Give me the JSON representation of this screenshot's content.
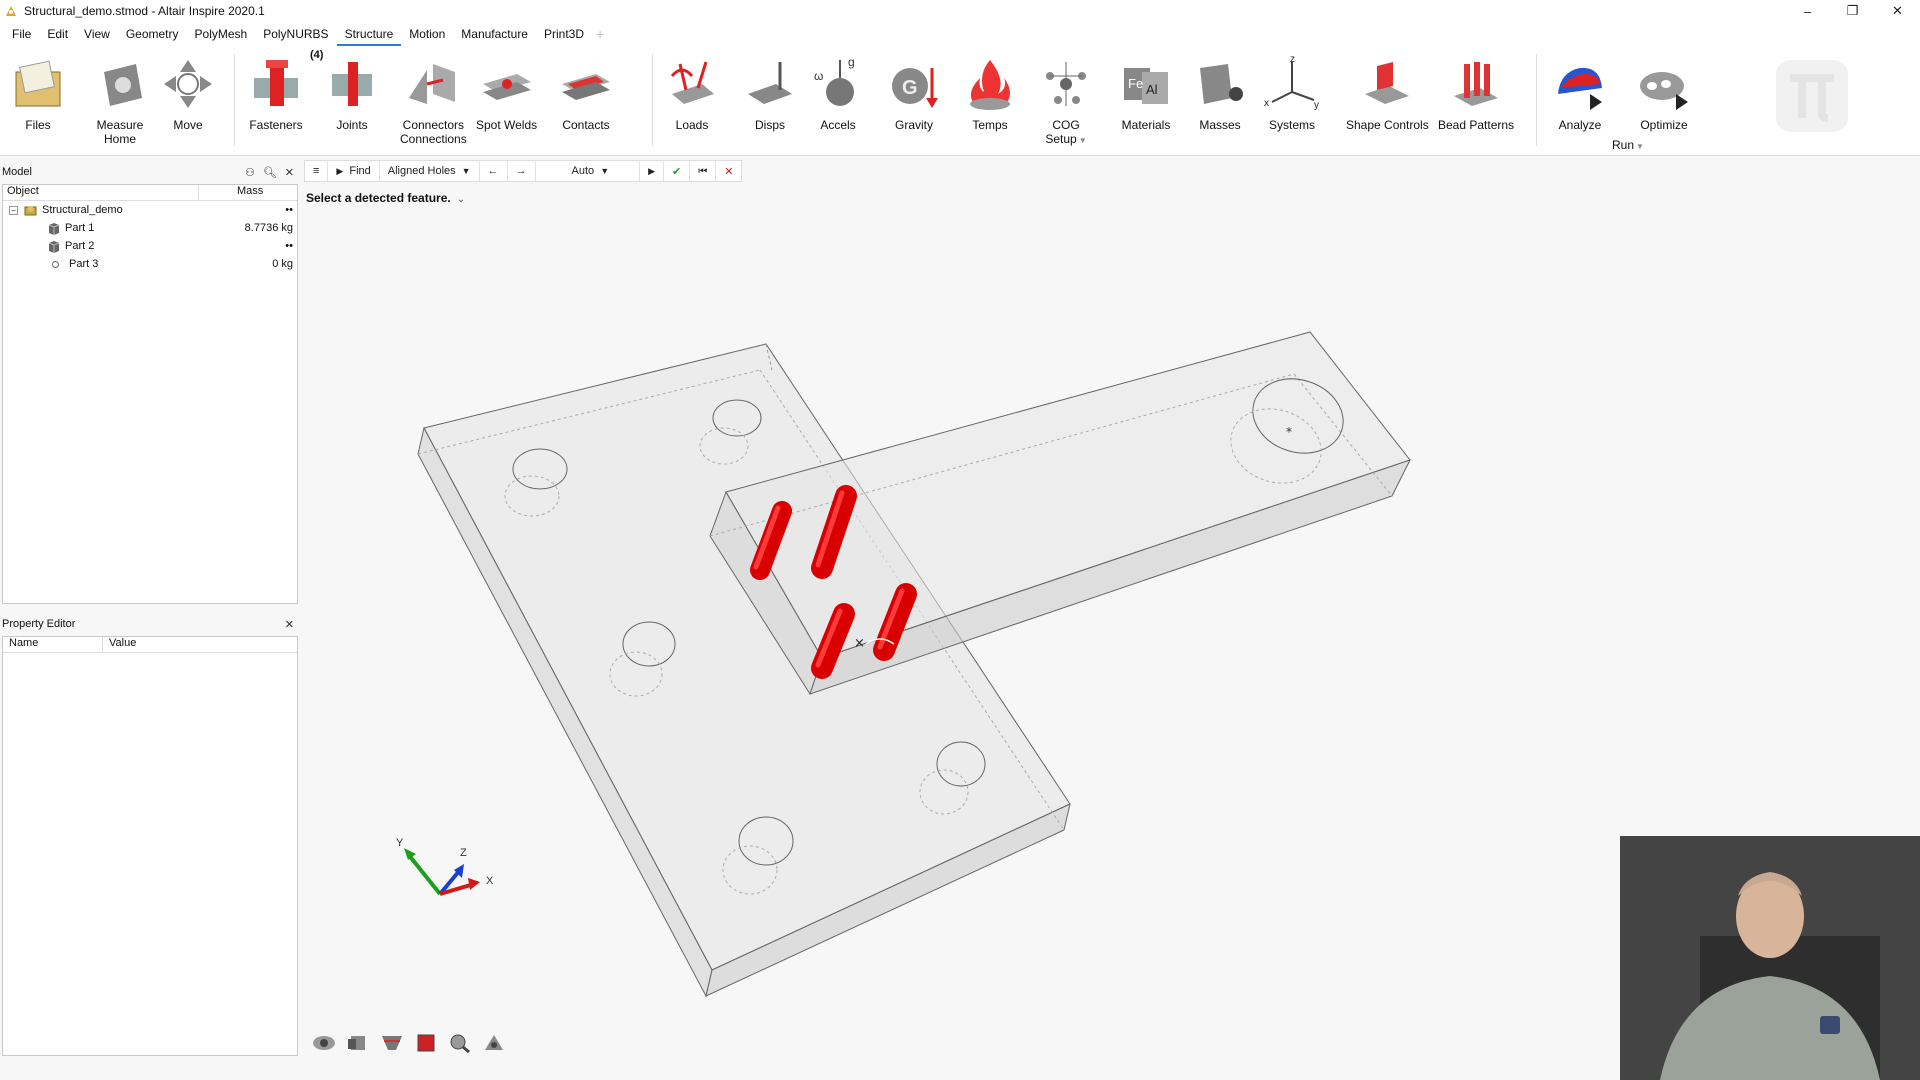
{
  "window": {
    "title": "Structural_demo.stmod - Altair Inspire 2020.1",
    "minimize": "–",
    "maximize": "❐",
    "close": "✕"
  },
  "menu": [
    "File",
    "Edit",
    "View",
    "Geometry",
    "PolyMesh",
    "PolyNURBS",
    "Structure",
    "Motion",
    "Manufacture",
    "Print3D"
  ],
  "menu_active": "Structure",
  "menu_add": "+",
  "ribbon": {
    "badge": "(4)",
    "buttons": [
      {
        "label": "Files",
        "icon": "files-icon"
      },
      {
        "label": "Measure\nHome",
        "icon": "measure-icon"
      },
      {
        "label": "Move",
        "icon": "move-icon"
      },
      {
        "label": "Fasteners",
        "icon": "fasteners-icon"
      },
      {
        "label": "Joints",
        "icon": "joints-icon"
      },
      {
        "label": "Connectors\nConnections",
        "icon": "connectors-icon"
      },
      {
        "label": "Spot Welds",
        "icon": "spot-welds-icon"
      },
      {
        "label": "Contacts",
        "icon": "contacts-icon"
      },
      {
        "label": "Loads",
        "icon": "loads-icon"
      },
      {
        "label": "Disps",
        "icon": "disps-icon"
      },
      {
        "label": "Accels",
        "icon": "accels-icon"
      },
      {
        "label": "Gravity",
        "icon": "gravity-icon"
      },
      {
        "label": "Temps",
        "icon": "temps-icon"
      },
      {
        "label": "COG\nSetup",
        "icon": "cog-icon"
      },
      {
        "label": "Materials",
        "icon": "materials-icon"
      },
      {
        "label": "Masses",
        "icon": "masses-icon"
      },
      {
        "label": "Systems",
        "icon": "systems-icon"
      },
      {
        "label": "Shape Controls",
        "icon": "shape-controls-icon"
      },
      {
        "label": "Bead Patterns",
        "icon": "bead-patterns-icon"
      },
      {
        "label": "Analyze",
        "icon": "analyze-icon"
      },
      {
        "label": "Optimize",
        "icon": "optimize-icon"
      }
    ],
    "run_label": "Run"
  },
  "model_panel": {
    "title": "Model",
    "columns": [
      "Object",
      "Mass"
    ],
    "root": {
      "name": "Structural_demo",
      "mass": "••"
    },
    "parts": [
      {
        "name": "Part 1",
        "mass": "8.7736 kg"
      },
      {
        "name": "Part 2",
        "mass": "••"
      },
      {
        "name": "Part 3",
        "mass": "0 kg"
      }
    ]
  },
  "property_editor": {
    "title": "Property Editor",
    "columns": [
      "Name",
      "Value"
    ]
  },
  "viewport_toolbar": {
    "menu": "≡",
    "find": "Find",
    "feature_type": "Aligned Holes",
    "prev": "←",
    "next": "→",
    "mode": "Auto",
    "play": "▶",
    "accept": "✔",
    "reset": "⏮",
    "cancel": "✕"
  },
  "hint": "Select a detected feature.",
  "triad": {
    "x": "X",
    "y": "Y",
    "z": "Z"
  },
  "systems_axes": {
    "x": "x",
    "y": "y",
    "z": "z"
  },
  "accels_labels": {
    "omega": "ω",
    "g": "g"
  },
  "colors": {
    "accent": "#2a7fd4",
    "fastener": "#e00000",
    "part_edge": "#555555",
    "part_fill": "#d6d6d6"
  }
}
